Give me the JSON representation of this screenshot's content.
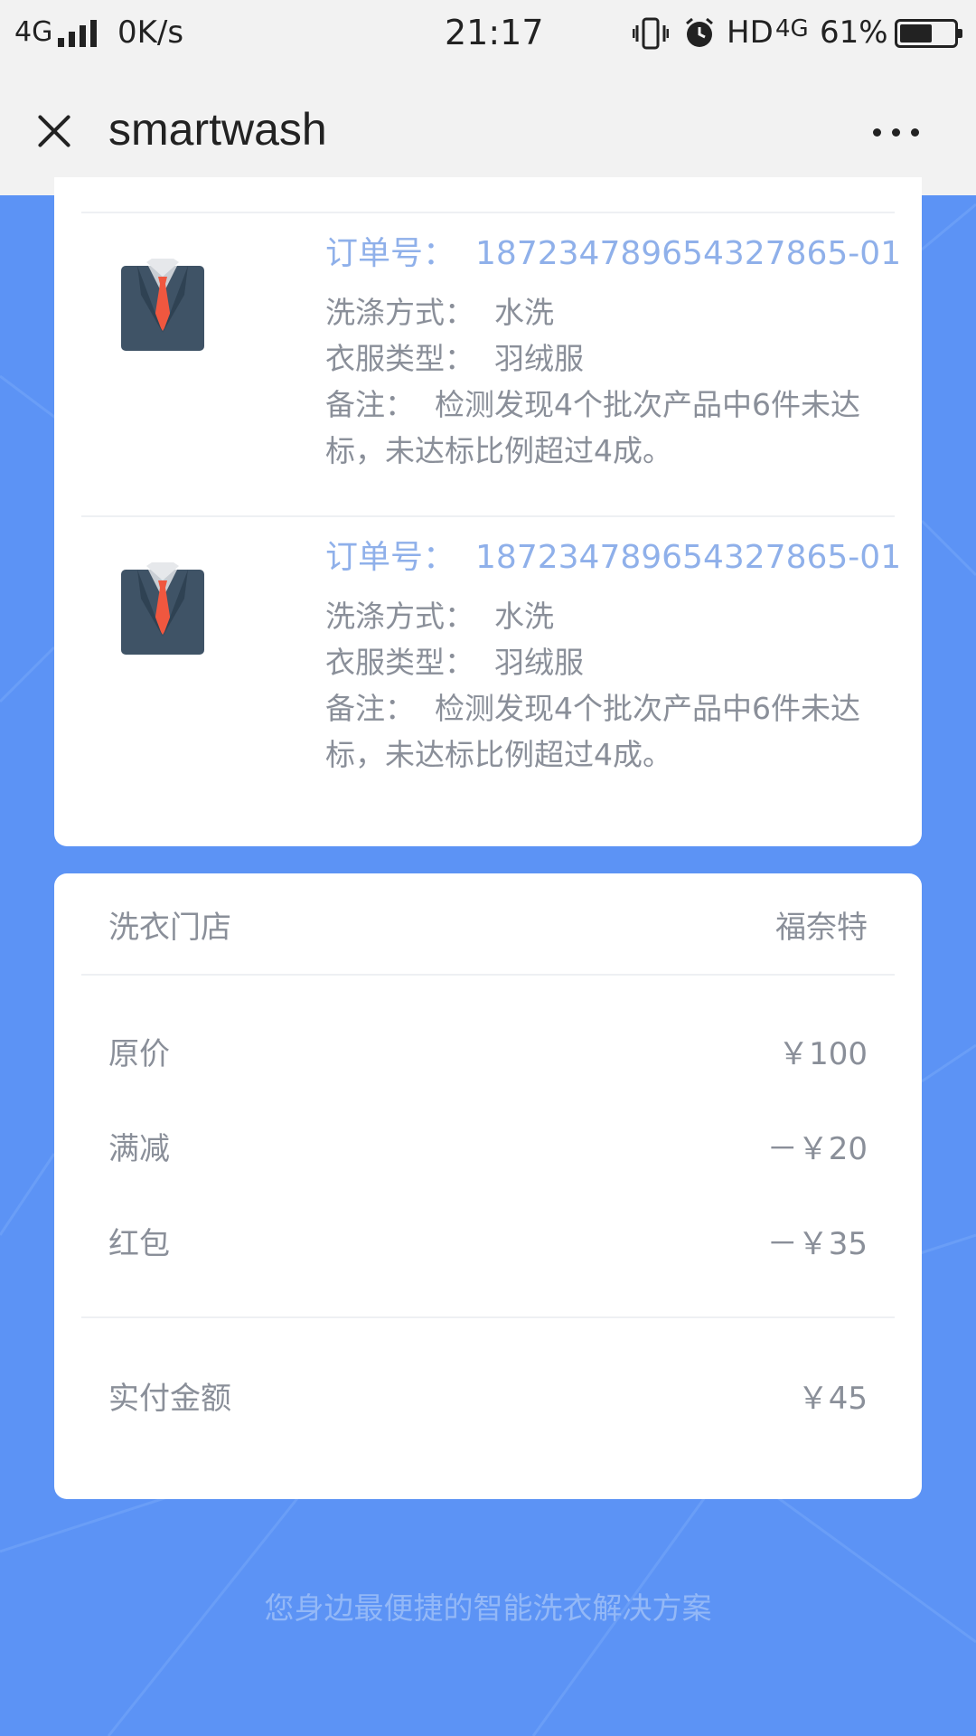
{
  "status_bar": {
    "network": "4G",
    "speed": "0K/s",
    "time": "21:17",
    "hd": "HD",
    "net2": "4G",
    "battery": "61%",
    "battery_level": 0.61
  },
  "title_bar": {
    "title": "smartwash"
  },
  "orders": [
    {
      "order_label": "订单号：",
      "order_no": "187234789654327865-01",
      "wash_label": "洗涤方式：",
      "wash_value": "水洗",
      "type_label": "衣服类型：",
      "type_value": "羽绒服",
      "remark_label": "备注：",
      "remark_value": "检测发现4个批次产品中6件未达标，未达标比例超过4成。"
    },
    {
      "order_label": "订单号：",
      "order_no": "187234789654327865-01",
      "wash_label": "洗涤方式：",
      "wash_value": "水洗",
      "type_label": "衣服类型：",
      "type_value": "羽绒服",
      "remark_label": "备注：",
      "remark_value": "检测发现4个批次产品中6件未达标，未达标比例超过4成。"
    }
  ],
  "price": {
    "store_label": "洗衣门店",
    "store_value": "福奈特",
    "original_label": "原价",
    "original_value": "￥100",
    "discount_label": "满减",
    "discount_value": "－￥20",
    "redpacket_label": "红包",
    "redpacket_value": "－￥35",
    "paid_label": "实付金额",
    "paid_value": "￥45"
  },
  "footer": {
    "slogan": "您身边最便捷的智能洗衣解决方案"
  },
  "colors": {
    "background": "#5c93f5",
    "order_no": "#8fb0ea",
    "text_gray": "#8a8f99",
    "suit_body": "#3f5366",
    "tie": "#f0573f"
  }
}
